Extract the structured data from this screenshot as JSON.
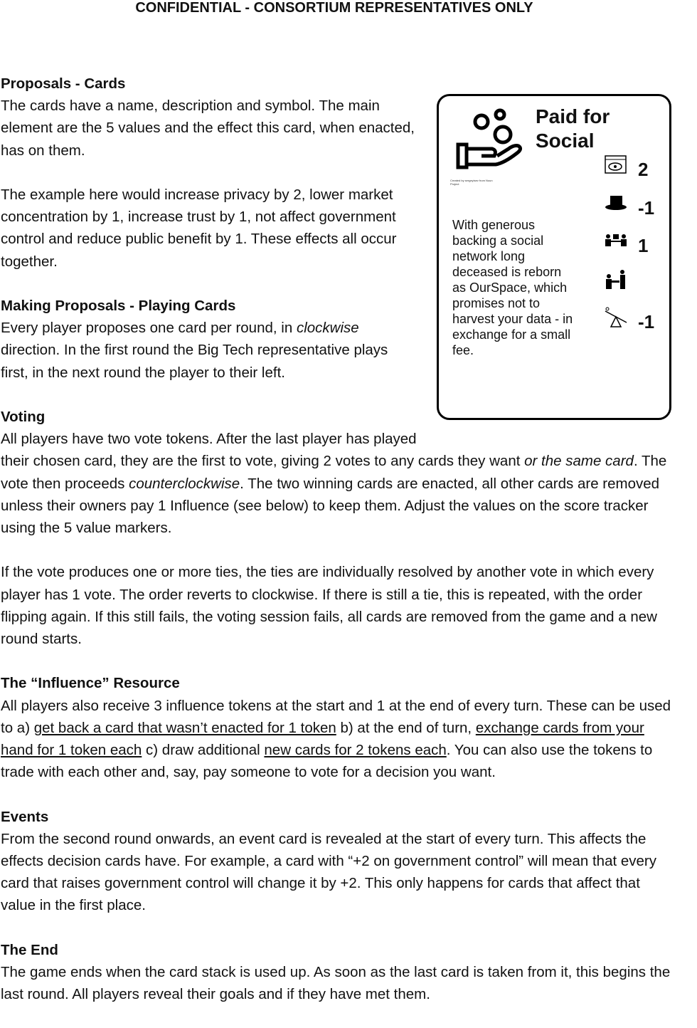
{
  "header": "CONFIDENTIAL - CONSORTIUM REPRESENTATIVES ONLY",
  "card": {
    "title": "Paid for Social",
    "credit": "Created by sergeyisev from Noun Project",
    "description": "With generous backing a social network long deceased is reborn as OurSpace, which promises not to harvest your data - in exchange for a small fee.",
    "values": [
      {
        "icon": "eye-window-icon",
        "value": "2"
      },
      {
        "icon": "top-hat-icon",
        "value": "-1"
      },
      {
        "icon": "people-lock-icon",
        "value": "1"
      },
      {
        "icon": "official-desk-icon",
        "value": ""
      },
      {
        "icon": "seesaw-icon",
        "value": "-1"
      }
    ]
  },
  "sections": {
    "proposals": {
      "heading": "Proposals - Cards",
      "p1": "The cards have a name, description and symbol. The main element are the 5 values and the effect this card, when enacted, has on them.",
      "p2": "The example here would increase privacy by 2, lower market concentration by 1, increase trust by 1, not affect government control and reduce public benefit by 1. These effects all occur together."
    },
    "making": {
      "heading": "Making Proposals - Playing Cards",
      "t1": "Every player proposes one card per round, in ",
      "em1": "clockwise",
      "t2": " direction. In the first round the Big Tech representative plays first, in the next round the player to their left."
    },
    "voting": {
      "heading": "Voting",
      "t1": "All players have two vote tokens. After the last player has played their chosen card, they are the first to vote, giving 2 votes to any cards they want ",
      "em1": "or the same card",
      "t2": ". The vote then proceeds ",
      "em2": "counterclockwise",
      "t3": ". The two winning cards are enacted, all other cards are removed unless their owners pay 1 Influence (see below) to keep them. Adjust the values on the score tracker using the 5 value markers.",
      "p2": "If the vote produces one or more ties, the ties are individually resolved by another vote in which every player has 1 vote. The order reverts to clockwise. If there is still a tie, this is repeated, with the order flipping again. If this still fails, the voting session fails, all cards are removed from the game and a new round starts."
    },
    "influence": {
      "heading": "The “Influence” Resource",
      "t1": "All players also receive 3 influence tokens at the start and 1 at the end of every turn. These can be used to a) ",
      "u1": "get back a card that wasn’t enacted for 1 token",
      "t2": " b) at the end of turn, ",
      "u2": "exchange cards from your hand for 1 token each",
      "t3": " c) draw additional ",
      "u3": "new cards for 2 tokens each",
      "t4": ". You can also use the tokens to trade with each other and, say, pay someone to vote for a decision you want."
    },
    "events": {
      "heading": "Events",
      "p1": "From the second round onwards, an event card is revealed at the start of every turn. This affects the effects decision cards have. For example, a card with “+2 on government control” will mean that every card that raises government control will change it by +2. This only happens for cards that affect that value in the first place."
    },
    "end": {
      "heading": "The End",
      "p1": "The game ends when the card stack is used up. As soon as the last card is taken from it, this begins the last round. All players reveal their goals and if they have met them."
    }
  }
}
